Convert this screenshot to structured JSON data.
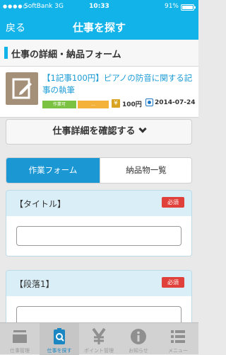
{
  "status_bar": {
    "signal": "●●●●○",
    "carrier": "SoftBank",
    "network": "3G",
    "time": "10:33",
    "battery_percent": "91%",
    "battery_level": 0.91
  },
  "nav": {
    "back_label": "戻る",
    "title": "仕事を探す"
  },
  "section": {
    "title": "仕事の詳細・納品フォーム"
  },
  "job": {
    "title": "【1記事100円】ピアノの防音に関する記事の執筆",
    "badge_green": "作業可",
    "badge_orange": "…",
    "yen_icon": "¥",
    "price": "100円",
    "date": "2014-07-24",
    "thumb_icon": "edit-document-icon"
  },
  "detail_button": {
    "label": "仕事詳細を確認する"
  },
  "tabs": {
    "work_form": "作業フォーム",
    "deliverables": "納品物一覧"
  },
  "fields": [
    {
      "label": "【タイトル】",
      "required": "必須"
    },
    {
      "label": "【段落1】",
      "required": "必須"
    }
  ],
  "tabbar": {
    "items": [
      {
        "label": "仕事管理",
        "icon": "inbox-icon"
      },
      {
        "label": "仕事を探す",
        "icon": "clipboard-search-icon"
      },
      {
        "label": "ポイント管理",
        "icon": "yen-icon"
      },
      {
        "label": "お知らせ",
        "icon": "info-icon"
      },
      {
        "label": "メニュー",
        "icon": "list-menu-icon"
      }
    ]
  },
  "colors": {
    "accent": "#12b3e8",
    "tab_active": "#1b97d4",
    "field_header": "#d9eef6",
    "required_red": "#e0413a"
  }
}
